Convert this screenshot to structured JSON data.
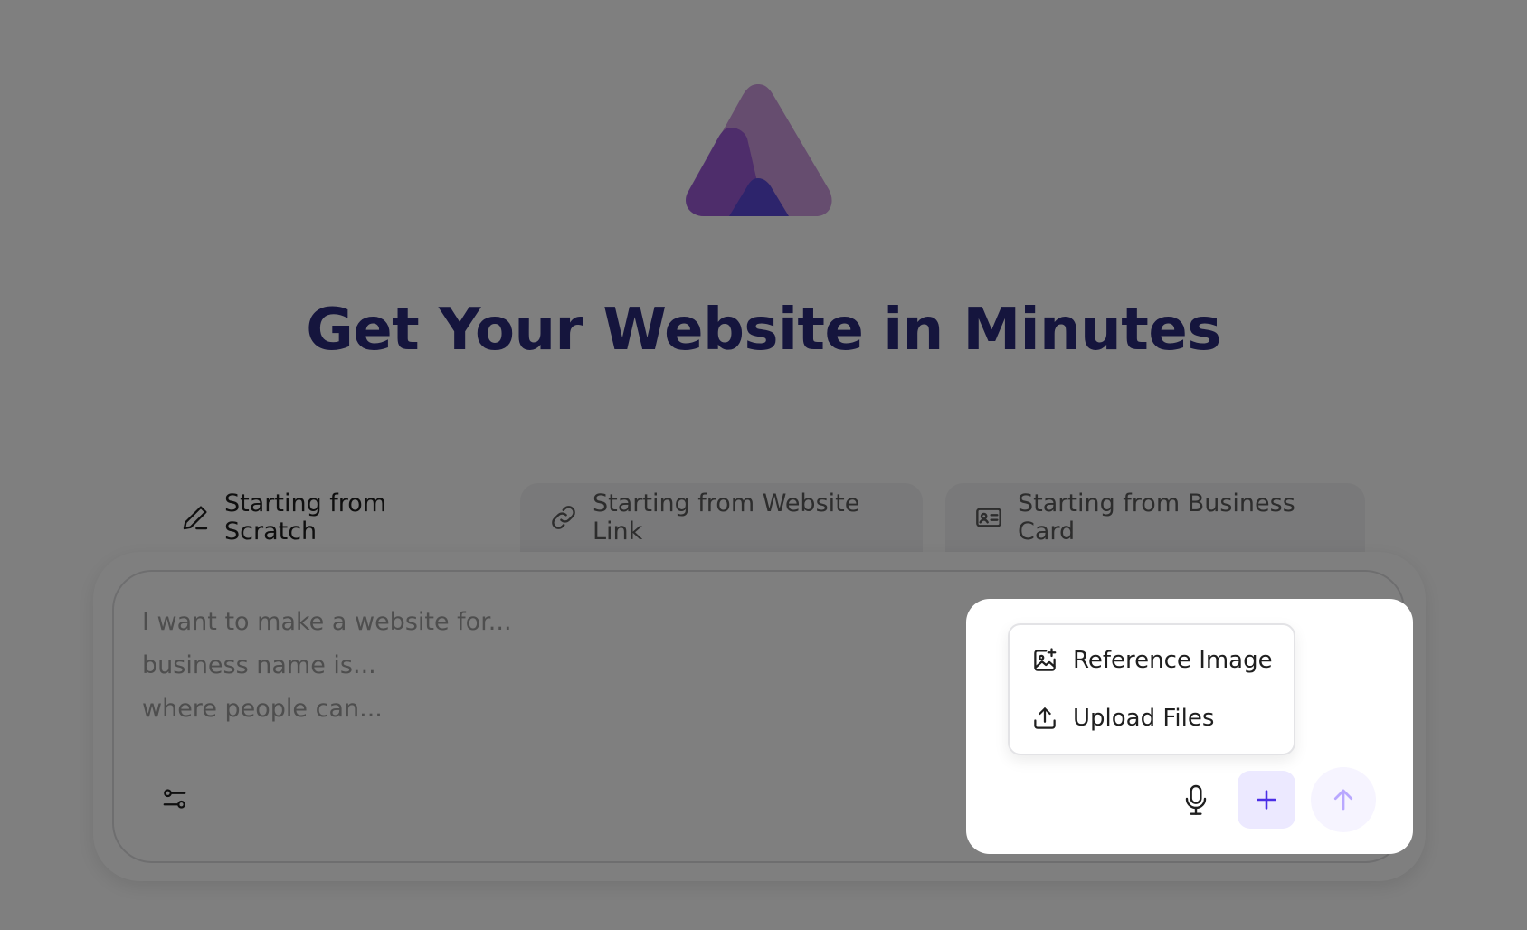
{
  "headline": "Get Your Website in Minutes",
  "tabs": [
    {
      "label": "Starting from Scratch",
      "icon": "pencil-icon",
      "active": true
    },
    {
      "label": "Starting from Website Link",
      "icon": "link-icon",
      "active": false
    },
    {
      "label": "Starting from Business Card",
      "icon": "id-card-icon",
      "active": false
    }
  ],
  "prompt": {
    "placeholder_lines": [
      "I want to make a website for...",
      "business name is...",
      "where people can..."
    ]
  },
  "attach_menu": {
    "items": [
      {
        "label": "Reference Image",
        "icon": "image-add-icon"
      },
      {
        "label": "Upload Files",
        "icon": "upload-icon"
      }
    ]
  },
  "colors": {
    "headline": "#2b2a7a",
    "accent": "#4b2ee6",
    "accent_light": "#ece9ff",
    "send_arrow": "#b9a8ff",
    "logo_back": "#c58ad6",
    "logo_mid": "#9a55d4",
    "logo_front": "#5b4fd8"
  }
}
